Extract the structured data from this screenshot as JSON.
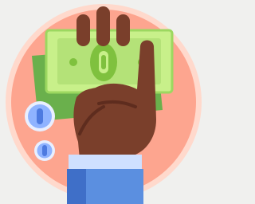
{
  "icon": {
    "subject": "hand-holding-cash-icon",
    "colors": {
      "page_background": "#f0f0ee",
      "circle_outer_ring": "#ffd9cc",
      "circle_fill": "#fda58f",
      "skin": "#7a3f2b",
      "skin_shadow": "#5e2c1e",
      "bill_back": "#6ab04c",
      "bill_front": "#c8f08a",
      "bill_edge": "#9cd860",
      "bill_inner": "#b4e278",
      "bill_emblem": "#7fc13e",
      "sleeve": "#5b8fe0",
      "sleeve_dark": "#3f6fc8",
      "cuff": "#cfe0ff",
      "coin": "#8fb3ff",
      "coin_ring": "#e9efff",
      "coin_mark": "#4d7ae0"
    }
  }
}
